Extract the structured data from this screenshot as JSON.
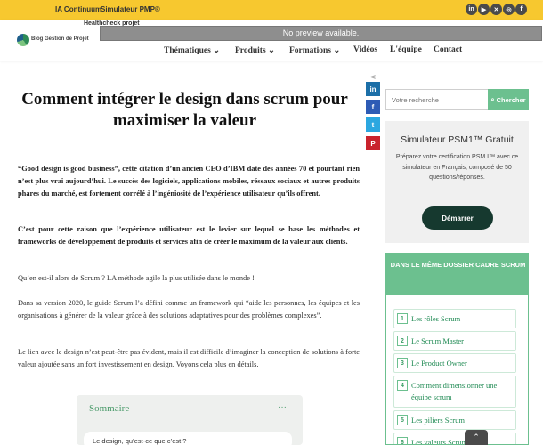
{
  "topbar": {
    "links": [
      "IA Continuum",
      "Simulateur PMP®"
    ],
    "healthcheck": "Healthcheck projet",
    "social_icons": [
      "linkedin-icon",
      "youtube-icon",
      "x-icon",
      "instagram-icon",
      "facebook-icon"
    ],
    "social_glyphs": [
      "in",
      "▶",
      "✕",
      "◎",
      "f"
    ]
  },
  "header": {
    "logo_text": "Blog Gestion de Projet",
    "preview_text": "No preview available.",
    "nav": [
      {
        "label": "Thématiques",
        "has_dropdown": true
      },
      {
        "label": "Produits",
        "has_dropdown": true
      },
      {
        "label": "Formations",
        "has_dropdown": true
      },
      {
        "label": "Vidéos",
        "has_dropdown": false
      },
      {
        "label": "L'équipe",
        "has_dropdown": false
      },
      {
        "label": "Contact",
        "has_dropdown": false
      }
    ],
    "chevron": "⌄"
  },
  "share": {
    "icons": [
      "share-icon",
      "linkedin-icon",
      "facebook-icon",
      "twitter-icon",
      "pinterest-icon"
    ],
    "glyphs": [
      "⋖",
      "in",
      "f",
      "t",
      "P"
    ]
  },
  "article": {
    "title": "Comment intégrer le design dans scrum pour maximiser la valeur",
    "paragraphs": [
      "“Good design is good business”, cette citation d’un ancien CEO d’IBM date des années 70 et pourtant rien n’est plus vrai aujourd’hui. Le succès des logiciels, applications mobiles, réseaux sociaux et autres produits phares du marché, est fortement corrélé à l’ingéniosité de l’expérience utilisateur qu’ils offrent.",
      "C’est pour cette raison que l’expérience utilisateur est le levier sur lequel se base les méthodes et frameworks de développement de produits et services afin de créer le maximum de la valeur aux clients.",
      "Qu’en est-il alors de Scrum ? LA méthode agile la plus utilisée dans le monde !",
      "Dans sa version 2020, le guide Scrum l’a défini comme un framework qui “aide les personnes, les équipes et les organisations à générer de la valeur grâce à des solutions adaptatives pour des problèmes complexes”.",
      "Le lien avec le design n’est peut-être pas évident, mais il est difficile d’imaginer la conception de solutions à forte valeur ajoutée sans un fort investissement en design. Voyons cela plus en détails."
    ],
    "toc": {
      "title": "Sommaire",
      "toggle": "···",
      "first_item": "Le design, qu’est-ce que c’est ?"
    }
  },
  "sidebar": {
    "search_placeholder": "Votre recherche",
    "search_button": "Chercher",
    "simulator": {
      "title": "Simulateur PSM1™ Gratuit",
      "description": "Préparez votre certification PSM I™ avec ce simulateur en Français, composé de 50 questions/réponses.",
      "button": "Démarrer"
    },
    "dossier": {
      "heading": "DANS LE MÊME DOSSIER CADRE SCRUM",
      "items": [
        {
          "num": "1",
          "label": "Les rôles Scrum"
        },
        {
          "num": "2",
          "label": "Le Scrum Master"
        },
        {
          "num": "3",
          "label": "Le Product Owner"
        },
        {
          "num": "4",
          "label": "Comment dimensionner une équipe scrum"
        },
        {
          "num": "5",
          "label": "Les piliers Scrum"
        },
        {
          "num": "6",
          "label": "Les valeurs Scrum"
        }
      ]
    },
    "scroll_top": "⌃"
  },
  "colors": {
    "topbar": "#f7c82f",
    "accent": "#6cc08f",
    "button_dark": "#16392f"
  }
}
